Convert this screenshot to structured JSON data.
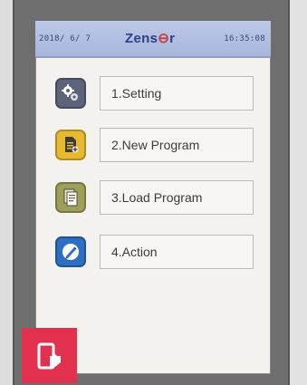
{
  "status_bar": {
    "date": "2018/ 6/ 7",
    "brand_prefix": "Zens",
    "brand_mark": "⊖",
    "brand_suffix": "r",
    "time": "16:35:08"
  },
  "menu": {
    "items": [
      {
        "label": "1.Setting",
        "icon": "gears-icon",
        "icon_color": "#5d6479"
      },
      {
        "label": "2.New Program",
        "icon": "new-document-icon",
        "icon_color": "#e8b92e"
      },
      {
        "label": "3.Load Program",
        "icon": "load-document-icon",
        "icon_color": "#9ea05a"
      },
      {
        "label": "4.Action",
        "icon": "pen-icon",
        "icon_color": "#2d6fc4"
      }
    ]
  },
  "overlay": {
    "icon": "mobile-tap-icon",
    "color": "#e2304f"
  }
}
